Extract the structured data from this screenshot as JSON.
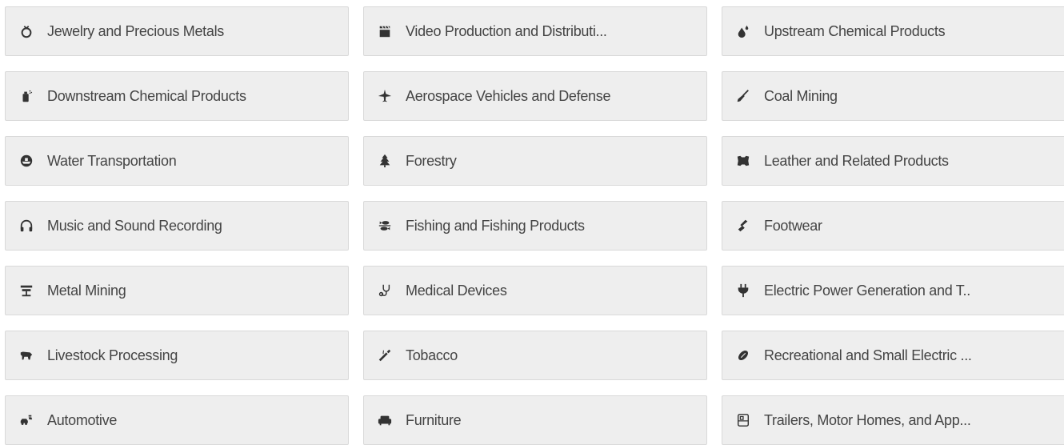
{
  "tiles": [
    {
      "label": "Jewelry and Precious Metals",
      "icon": "ring-icon"
    },
    {
      "label": "Video Production and Distributi...",
      "icon": "film-clapper-icon"
    },
    {
      "label": "Upstream Chemical Products",
      "icon": "droplets-icon"
    },
    {
      "label": "Downstream Chemical Products",
      "icon": "spray-can-icon"
    },
    {
      "label": "Aerospace Vehicles and Defense",
      "icon": "plane-icon"
    },
    {
      "label": "Coal Mining",
      "icon": "shovel-icon"
    },
    {
      "label": "Water Transportation",
      "icon": "ship-icon"
    },
    {
      "label": "Forestry",
      "icon": "tree-icon"
    },
    {
      "label": "Leather and Related Products",
      "icon": "leather-hide-icon"
    },
    {
      "label": "Music and Sound Recording",
      "icon": "headphones-icon"
    },
    {
      "label": "Fishing and Fishing Products",
      "icon": "fish-icon"
    },
    {
      "label": "Footwear",
      "icon": "shoe-icon"
    },
    {
      "label": "Metal Mining",
      "icon": "ingot-icon"
    },
    {
      "label": "Medical Devices",
      "icon": "stethoscope-icon"
    },
    {
      "label": "Electric Power Generation and T..",
      "icon": "plug-icon"
    },
    {
      "label": "Livestock Processing",
      "icon": "cow-icon"
    },
    {
      "label": "Tobacco",
      "icon": "cigarette-icon"
    },
    {
      "label": "Recreational and Small Electric ...",
      "icon": "football-icon"
    },
    {
      "label": "Automotive",
      "icon": "car-icon"
    },
    {
      "label": "Furniture",
      "icon": "sofa-icon"
    },
    {
      "label": "Trailers, Motor Homes, and App...",
      "icon": "trailer-icon"
    }
  ],
  "colors": {
    "tile_background": "#eeeeee",
    "tile_border": "#d9d9d9",
    "text": "#444444",
    "icon": "#333333"
  }
}
